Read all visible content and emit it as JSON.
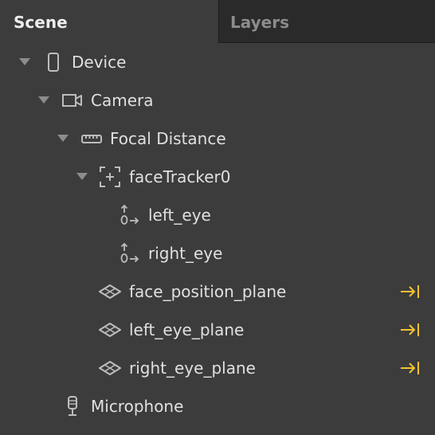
{
  "tabs": {
    "scene": "Scene",
    "layers": "Layers"
  },
  "tree": {
    "device": "Device",
    "camera": "Camera",
    "focal_distance": "Focal Distance",
    "face_tracker": "faceTracker0",
    "left_eye": "left_eye",
    "right_eye": "right_eye",
    "face_position_plane": "face_position_plane",
    "left_eye_plane": "left_eye_plane",
    "right_eye_plane": "right_eye_plane",
    "microphone": "Microphone"
  },
  "colors": {
    "panel_bg": "#3c3c3c",
    "inactive_tab_bg": "#2a2a2a",
    "text": "#e0e0e0",
    "icon": "#bdbdbd",
    "link_accent": "#f2c230"
  },
  "icons": {
    "device": "phone-icon",
    "camera": "camera-icon",
    "focal_distance": "ruler-icon",
    "face_tracker": "face-tracker-icon",
    "eye": "null-object-icon",
    "plane": "plane-icon",
    "link": "link-arrow-icon",
    "microphone": "microphone-icon"
  }
}
